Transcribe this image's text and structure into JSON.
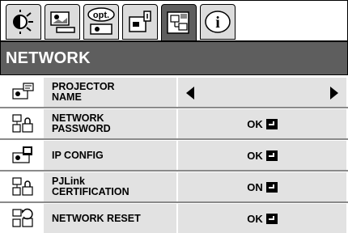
{
  "tabs": [
    {
      "name": "image-adjust",
      "icon": "brightness-icon"
    },
    {
      "name": "display",
      "icon": "screen-image-icon"
    },
    {
      "name": "options",
      "icon": "opt-icon",
      "label": "opt."
    },
    {
      "name": "setup",
      "icon": "projector-setup-icon"
    },
    {
      "name": "network",
      "icon": "network-icon",
      "active": true
    },
    {
      "name": "information",
      "icon": "info-icon",
      "label": "i"
    }
  ],
  "menu": {
    "title": "NETWORK",
    "rows": [
      {
        "label": "PROJECTOR\nNAME",
        "icon": "projector-name-icon",
        "value": "",
        "type": "selector"
      },
      {
        "label": "NETWORK\nPASSWORD",
        "icon": "network-password-icon",
        "value": "OK",
        "type": "enter"
      },
      {
        "label": "IP CONFIG",
        "icon": "ip-config-icon",
        "value": "OK",
        "type": "enter"
      },
      {
        "label": "PJLink\nCERTIFICATION",
        "icon": "pjlink-icon",
        "value": "ON",
        "type": "enter"
      },
      {
        "label": "NETWORK RESET",
        "icon": "network-reset-icon",
        "value": "OK",
        "type": "enter"
      }
    ]
  },
  "colors": {
    "active_tab": "#5e5e5e",
    "inactive_tab": "#dcdcdc",
    "row_background": "#e2e2e2",
    "title_text": "#ffffff"
  }
}
